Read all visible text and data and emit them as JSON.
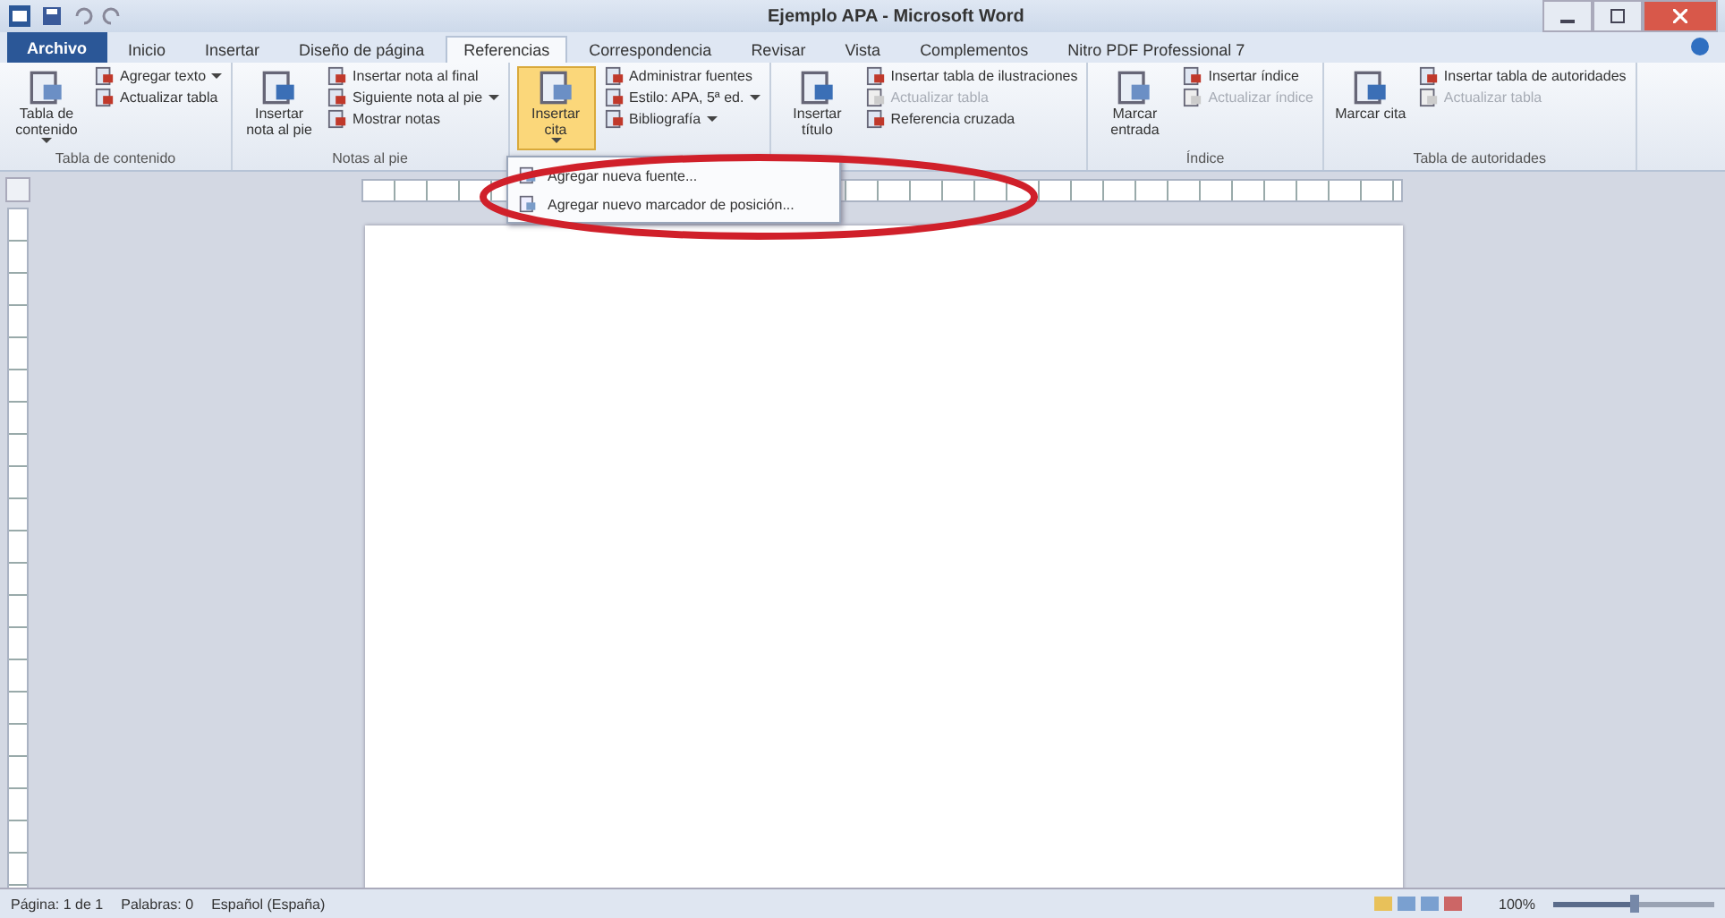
{
  "window": {
    "title": "Ejemplo APA - Microsoft Word"
  },
  "tabs": [
    {
      "label": "Archivo",
      "kind": "file",
      "selected": false
    },
    {
      "label": "Inicio",
      "kind": "tab",
      "selected": false
    },
    {
      "label": "Insertar",
      "kind": "tab",
      "selected": false
    },
    {
      "label": "Diseño de página",
      "kind": "tab",
      "selected": false
    },
    {
      "label": "Referencias",
      "kind": "tab",
      "selected": true
    },
    {
      "label": "Correspondencia",
      "kind": "tab",
      "selected": false
    },
    {
      "label": "Revisar",
      "kind": "tab",
      "selected": false
    },
    {
      "label": "Vista",
      "kind": "tab",
      "selected": false
    },
    {
      "label": "Complementos",
      "kind": "tab",
      "selected": false
    },
    {
      "label": "Nitro PDF Professional 7",
      "kind": "tab",
      "selected": false
    }
  ],
  "ribbon": {
    "groups": [
      {
        "label": "Tabla de contenido",
        "columns": [
          {
            "kind": "large",
            "label": "Tabla de contenido",
            "dropdown": true,
            "pressed": false
          },
          {
            "kind": "stack",
            "items": [
              {
                "label": "Agregar texto",
                "dropdown": true,
                "disabled": false
              },
              {
                "label": "Actualizar tabla",
                "dropdown": false,
                "disabled": false
              }
            ]
          }
        ]
      },
      {
        "label": "Notas al pie",
        "columns": [
          {
            "kind": "large",
            "label": "Insertar nota al pie",
            "dropdown": false,
            "pressed": false
          },
          {
            "kind": "stack",
            "items": [
              {
                "label": "Insertar nota al final",
                "dropdown": false,
                "disabled": false
              },
              {
                "label": "Siguiente nota al pie",
                "dropdown": true,
                "disabled": false
              },
              {
                "label": "Mostrar notas",
                "dropdown": false,
                "disabled": false
              }
            ]
          }
        ]
      },
      {
        "columns": [
          {
            "kind": "large",
            "label": "Insertar cita",
            "dropdown": true,
            "pressed": true
          },
          {
            "kind": "stack",
            "items": [
              {
                "label": "Administrar fuentes",
                "dropdown": false,
                "disabled": false
              },
              {
                "label": "Estilo: APA, 5ª ed.",
                "dropdown": true,
                "disabled": false
              },
              {
                "label": "Bibliografía",
                "dropdown": true,
                "disabled": false
              }
            ]
          }
        ]
      },
      {
        "columns": [
          {
            "kind": "large",
            "label": "Insertar título",
            "dropdown": false,
            "pressed": false
          },
          {
            "kind": "stack",
            "items": [
              {
                "label": "Insertar tabla de ilustraciones",
                "dropdown": false,
                "disabled": false
              },
              {
                "label": "Actualizar tabla",
                "dropdown": false,
                "disabled": true
              },
              {
                "label": "Referencia cruzada",
                "dropdown": false,
                "disabled": false
              }
            ]
          }
        ]
      },
      {
        "label": "Índice",
        "columns": [
          {
            "kind": "large",
            "label": "Marcar entrada",
            "dropdown": false,
            "pressed": false
          },
          {
            "kind": "stack",
            "items": [
              {
                "label": "Insertar índice",
                "dropdown": false,
                "disabled": false
              },
              {
                "label": "Actualizar índice",
                "dropdown": false,
                "disabled": true
              }
            ]
          }
        ]
      },
      {
        "label": "Tabla de autoridades",
        "columns": [
          {
            "kind": "large",
            "label": "Marcar cita",
            "dropdown": false,
            "pressed": false
          },
          {
            "kind": "stack",
            "items": [
              {
                "label": "Insertar tabla de autoridades",
                "dropdown": false,
                "disabled": false
              },
              {
                "label": "Actualizar tabla",
                "dropdown": false,
                "disabled": true
              }
            ]
          }
        ]
      }
    ]
  },
  "dropdown_menu": {
    "items": [
      {
        "label": "Agregar nueva fuente..."
      },
      {
        "label": "Agregar nuevo marcador de posición..."
      }
    ]
  },
  "status_bar": {
    "items": [
      {
        "label": "Página: 1 de 1"
      },
      {
        "label": "Palabras: 0"
      },
      {
        "label": "Español (España)"
      }
    ],
    "zoom": "100%",
    "zoom_slider": {
      "level": 0.5
    }
  }
}
